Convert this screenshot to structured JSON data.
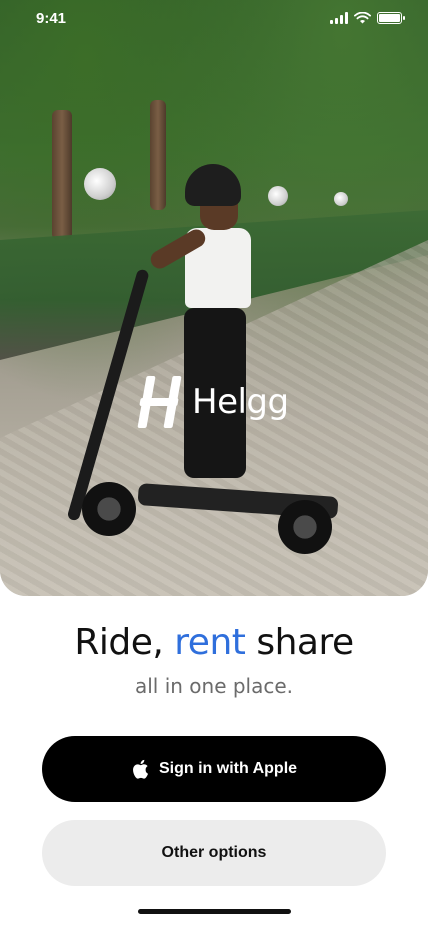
{
  "status_bar": {
    "time": "9:41"
  },
  "brand": {
    "name": "Helgg"
  },
  "headline": {
    "part1": "Ride, ",
    "accent": "rent",
    "part2": " share"
  },
  "subline": "all in one place.",
  "buttons": {
    "apple_label": "Sign in with Apple",
    "other_label": "Other options"
  },
  "colors": {
    "accent": "#2f6fdc",
    "primary_button": "#000000",
    "secondary_button": "#ececec"
  },
  "icons": [
    "apple-icon",
    "signal-icon",
    "wifi-icon",
    "battery-icon",
    "helgg-logo-icon"
  ]
}
